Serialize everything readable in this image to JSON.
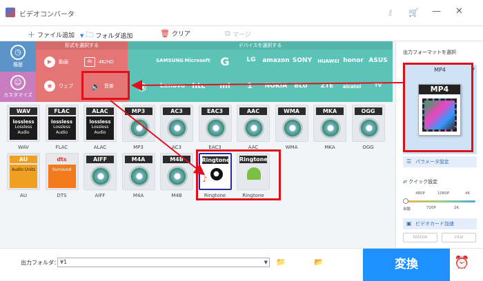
{
  "app": {
    "title": "ビデオコンバータ"
  },
  "toolbar": {
    "add_file": "ファイル追加",
    "add_folder": "フォルダ追加",
    "clear": "クリア",
    "merge": "マージ"
  },
  "left_nav": {
    "history": "履歴",
    "customize": "カスタマイズ"
  },
  "format_panel": {
    "header": "形式を選択する",
    "items": [
      "動画",
      "4K/HD",
      "ウェブ",
      "音楽"
    ]
  },
  "device_panel": {
    "header": "デバイスを選択する",
    "row1": [
      "",
      "SAMSUNG",
      "Microsoft",
      "G",
      "LG",
      "amazon",
      "SONY",
      "HUAWEI",
      "honor",
      "ASUS"
    ],
    "row2": [
      "",
      "Lenovo",
      "htc",
      "mi",
      "1",
      "NOKIA",
      "BLU",
      "ZTE",
      "alcatel",
      "TV"
    ]
  },
  "formats": [
    {
      "tag": "WAV",
      "label": "WAV",
      "kind": "lossless"
    },
    {
      "tag": "FLAC",
      "label": "FLAC",
      "kind": "lossless"
    },
    {
      "tag": "ALAC",
      "label": "ALAC",
      "kind": "lossless"
    },
    {
      "tag": "MP3",
      "label": "MP3",
      "kind": "disc"
    },
    {
      "tag": "AC3",
      "label": "AC3",
      "kind": "disc"
    },
    {
      "tag": "EAC3",
      "label": "EAC3",
      "kind": "disc"
    },
    {
      "tag": "AAC",
      "label": "AAC",
      "kind": "disc"
    },
    {
      "tag": "WMA",
      "label": "WMA",
      "kind": "disc"
    },
    {
      "tag": "MKA",
      "label": "MKA",
      "kind": "disc"
    },
    {
      "tag": "OGG",
      "label": "OGG",
      "kind": "disc"
    },
    {
      "tag": "AU",
      "label": "AU",
      "kind": "au"
    },
    {
      "tag": "dts",
      "label": "DTS",
      "kind": "dts"
    },
    {
      "tag": "AIFF",
      "label": "AIFF",
      "kind": "disc"
    },
    {
      "tag": "M4A",
      "label": "M4A",
      "kind": "disc"
    },
    {
      "tag": "M4B",
      "label": "M4B",
      "kind": "disc"
    },
    {
      "tag": "Ringtone",
      "label": "Ringtone",
      "kind": "apple"
    },
    {
      "tag": "Ringtone",
      "label": "Ringtone",
      "kind": "android"
    }
  ],
  "lossless_text": "Lossless Audio",
  "lossless_logo": "lossless",
  "au_caption": "Audio Units",
  "dts_caption": "Surround",
  "right_panel": {
    "title": "出力フォーマットを選択",
    "format": "MP4",
    "icon_text": "MP4",
    "param_btn": "パラメータ設定",
    "quick": "クイック設定",
    "top_labels": [
      "480P",
      "1080P",
      "4K"
    ],
    "bottom_labels": [
      "自動",
      "720P",
      "2K"
    ],
    "gpu_btn": "ビデオカード加速",
    "hw": [
      "NVIDIA",
      "intel"
    ]
  },
  "bottom": {
    "output_label": "出力フォルダ：",
    "output_value": "¥1",
    "convert": "変換"
  },
  "colors": {
    "accent": "#1e90ff",
    "format_panel": "#e57575",
    "device_panel": "#5cc3b9",
    "highlight": "#e0101a"
  }
}
